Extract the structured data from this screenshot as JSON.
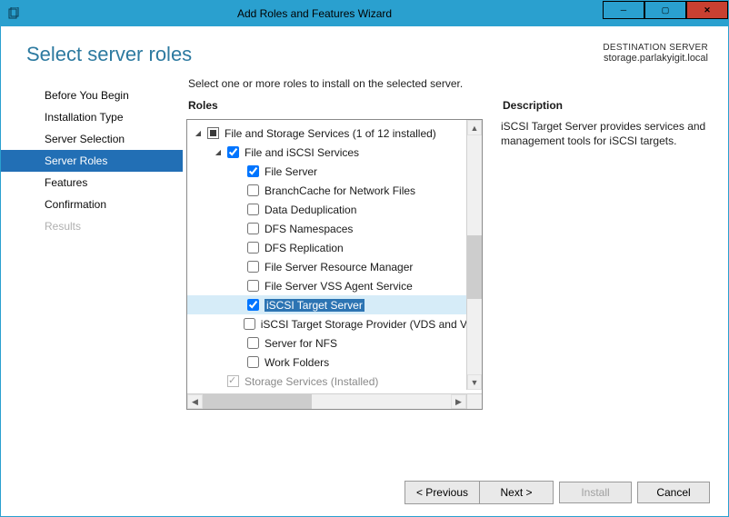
{
  "window": {
    "title": "Add Roles and Features Wizard"
  },
  "header": {
    "page_title": "Select server roles",
    "dest_label": "DESTINATION SERVER",
    "dest_value": "storage.parlakyigit.local"
  },
  "instruction": "Select one or more roles to install on the selected server.",
  "sections": {
    "roles": "Roles",
    "description": "Description"
  },
  "nav": {
    "items": [
      {
        "label": "Before You Begin",
        "state": "normal"
      },
      {
        "label": "Installation Type",
        "state": "normal"
      },
      {
        "label": "Server Selection",
        "state": "normal"
      },
      {
        "label": "Server Roles",
        "state": "active"
      },
      {
        "label": "Features",
        "state": "normal"
      },
      {
        "label": "Confirmation",
        "state": "normal"
      },
      {
        "label": "Results",
        "state": "disabled"
      }
    ]
  },
  "tree": {
    "rows": [
      {
        "indent": 0,
        "expander": "open",
        "check": "mixed",
        "label": "File and Storage Services (1 of 12 installed)"
      },
      {
        "indent": 1,
        "expander": "open",
        "check": "checked",
        "label": "File and iSCSI Services"
      },
      {
        "indent": 2,
        "expander": "none",
        "check": "checked",
        "label": "File Server"
      },
      {
        "indent": 2,
        "expander": "none",
        "check": "unchecked",
        "label": "BranchCache for Network Files"
      },
      {
        "indent": 2,
        "expander": "none",
        "check": "unchecked",
        "label": "Data Deduplication"
      },
      {
        "indent": 2,
        "expander": "none",
        "check": "unchecked",
        "label": "DFS Namespaces"
      },
      {
        "indent": 2,
        "expander": "none",
        "check": "unchecked",
        "label": "DFS Replication"
      },
      {
        "indent": 2,
        "expander": "none",
        "check": "unchecked",
        "label": "File Server Resource Manager"
      },
      {
        "indent": 2,
        "expander": "none",
        "check": "unchecked",
        "label": "File Server VSS Agent Service"
      },
      {
        "indent": 2,
        "expander": "none",
        "check": "checked",
        "label": "iSCSI Target Server",
        "selected": true
      },
      {
        "indent": 2,
        "expander": "none",
        "check": "unchecked",
        "label": "iSCSI Target Storage Provider (VDS and VSS"
      },
      {
        "indent": 2,
        "expander": "none",
        "check": "unchecked",
        "label": "Server for NFS"
      },
      {
        "indent": 2,
        "expander": "none",
        "check": "unchecked",
        "label": "Work Folders"
      },
      {
        "indent": 1,
        "expander": "none",
        "check": "dim-checked",
        "label": "Storage Services (Installed)",
        "dim": true
      }
    ]
  },
  "description": {
    "text": "iSCSI Target Server provides services and management tools for iSCSI targets."
  },
  "buttons": {
    "previous": "< Previous",
    "next": "Next >",
    "install": "Install",
    "cancel": "Cancel"
  }
}
